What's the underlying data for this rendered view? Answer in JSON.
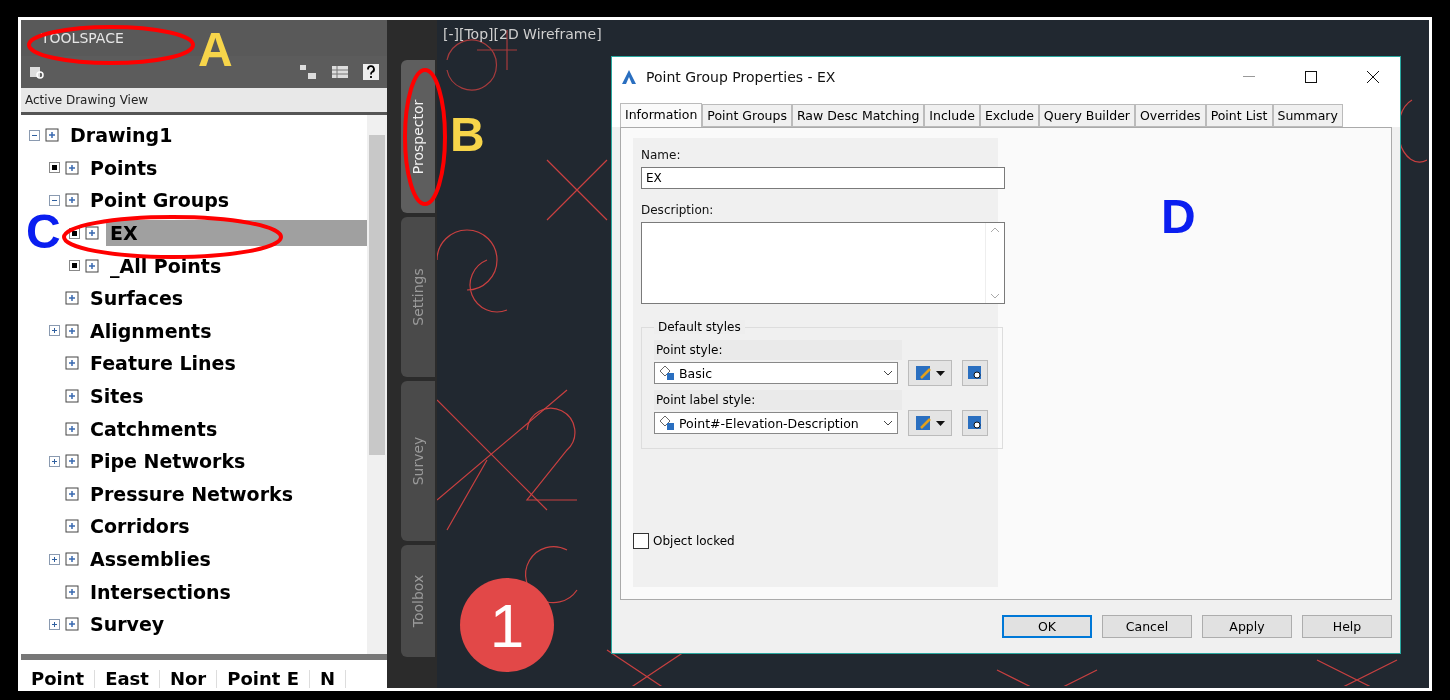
{
  "toolspace": {
    "title": "TOOLSPACE",
    "view": "Active Drawing View",
    "tree": [
      {
        "label": "Drawing1",
        "expanded": true,
        "selected": false,
        "children": [
          {
            "label": "Points",
            "kind": "dot",
            "selected": false
          },
          {
            "label": "Point Groups",
            "expanded": true,
            "selected": false,
            "children": [
              {
                "label": "EX",
                "kind": "dot",
                "selected": true
              },
              {
                "label": "_All Points",
                "kind": "dot",
                "selected": false
              }
            ]
          },
          {
            "label": "Surfaces",
            "selected": false
          },
          {
            "label": "Alignments",
            "expanded": false,
            "selected": false
          },
          {
            "label": "Feature Lines",
            "selected": false
          },
          {
            "label": "Sites",
            "selected": false
          },
          {
            "label": "Catchments",
            "selected": false
          },
          {
            "label": "Pipe Networks",
            "expanded": false,
            "selected": false
          },
          {
            "label": "Pressure Networks",
            "selected": false
          },
          {
            "label": "Corridors",
            "selected": false
          },
          {
            "label": "Assemblies",
            "expanded": false,
            "selected": false
          },
          {
            "label": "Intersections",
            "selected": false
          },
          {
            "label": "Survey",
            "expanded": false,
            "selected": false
          }
        ]
      }
    ],
    "columns": [
      "Point",
      "East",
      "Nor",
      "Point E",
      "N"
    ],
    "side_tabs": [
      {
        "label": "Prospector",
        "selected": true
      },
      {
        "label": "Settings",
        "selected": false
      },
      {
        "label": "Survey",
        "selected": false
      },
      {
        "label": "Toolbox",
        "selected": false
      }
    ]
  },
  "viewport": {
    "label": "[-][Top][2D Wireframe]"
  },
  "dialog": {
    "title": "Point Group Properties - EX",
    "tabs": [
      {
        "label": "Information",
        "selected": true
      },
      {
        "label": "Point Groups",
        "selected": false
      },
      {
        "label": "Raw Desc Matching",
        "selected": false
      },
      {
        "label": "Include",
        "selected": false
      },
      {
        "label": "Exclude",
        "selected": false
      },
      {
        "label": "Query Builder",
        "selected": false
      },
      {
        "label": "Overrides",
        "selected": false
      },
      {
        "label": "Point List",
        "selected": false
      },
      {
        "label": "Summary",
        "selected": false
      }
    ],
    "name_label": "Name:",
    "name_value": "EX",
    "description_label": "Description:",
    "group_label": "Default styles",
    "styles": [
      {
        "label": "Point style:",
        "value": "Basic"
      },
      {
        "label": "Point label style:",
        "value": "Point#-Elevation-Description"
      }
    ],
    "locked": {
      "label": "Object locked",
      "checked": false
    },
    "buttons": [
      {
        "label": "OK",
        "selected": true
      },
      {
        "label": "Cancel",
        "selected": false
      },
      {
        "label": "Apply",
        "selected": false
      },
      {
        "label": "Help",
        "selected": false
      }
    ]
  },
  "annotations": [
    {
      "kind": "ellipse"
    },
    {
      "kind": "ellipse"
    },
    {
      "kind": "ellipse"
    },
    {
      "kind": "letter",
      "text": "A",
      "color": "#f7d54a"
    },
    {
      "kind": "letter",
      "text": "B",
      "color": "#f7d54a"
    },
    {
      "kind": "letter",
      "text": "C",
      "color": "#0a1ef0"
    },
    {
      "kind": "letter",
      "text": "D",
      "color": "#0a1ef0"
    },
    {
      "kind": "badge",
      "text": "1"
    }
  ]
}
